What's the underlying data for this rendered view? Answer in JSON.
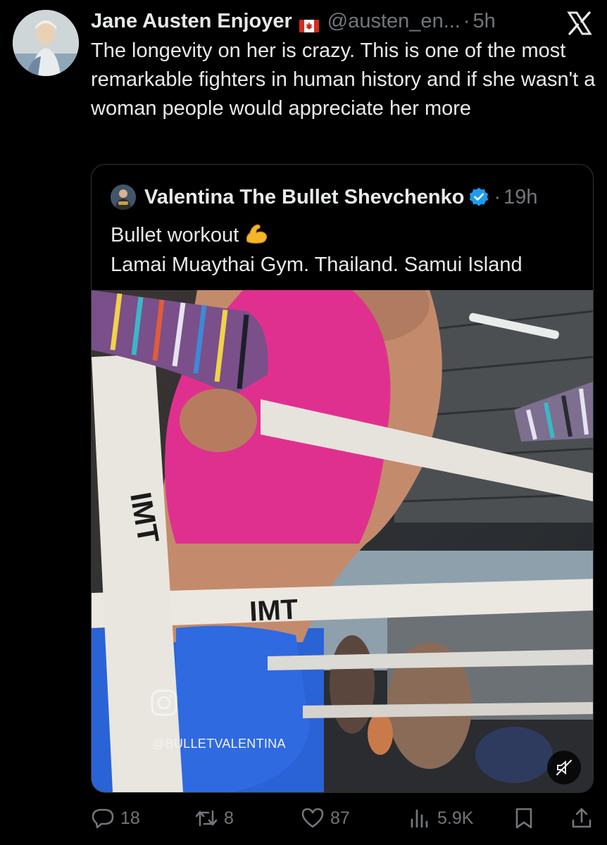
{
  "author": {
    "name": "Jane Austen Enjoyer",
    "flag_icon": "canada-flag-icon",
    "handle": "@austen_en...",
    "separator": "·",
    "time": "5h"
  },
  "platform_icon": "x-logo-icon",
  "tweet": {
    "text": "The longevity on her is crazy. This is one of the most remarkable fighters in human history and if she wasn't a woman people would appreciate her more"
  },
  "quoted": {
    "name": "Valentina The Bullet Shevchenko",
    "verified_icon": "verified-badge-icon",
    "separator": "·",
    "time": "19h",
    "line1": "Bullet workout",
    "emoji_icon": "flexed-biceps-icon",
    "line2": "Lamai Muaythai Gym. Thailand. Samui Island",
    "media": {
      "watermark_icon": "instagram-icon",
      "watermark_handle": "@BULLETVALENTINA",
      "mute_icon": "muted-speaker-icon"
    }
  },
  "actions": {
    "replies": "18",
    "reposts": "8",
    "likes": "87",
    "views": "5.9K"
  },
  "colors": {
    "background": "#000000",
    "primary_text": "#e7e9ea",
    "secondary_text": "#71767b",
    "border": "#2f3336",
    "verified": "#1d9bf0",
    "top_pink": "#e0308f",
    "shorts_blue": "#2a63d6"
  }
}
